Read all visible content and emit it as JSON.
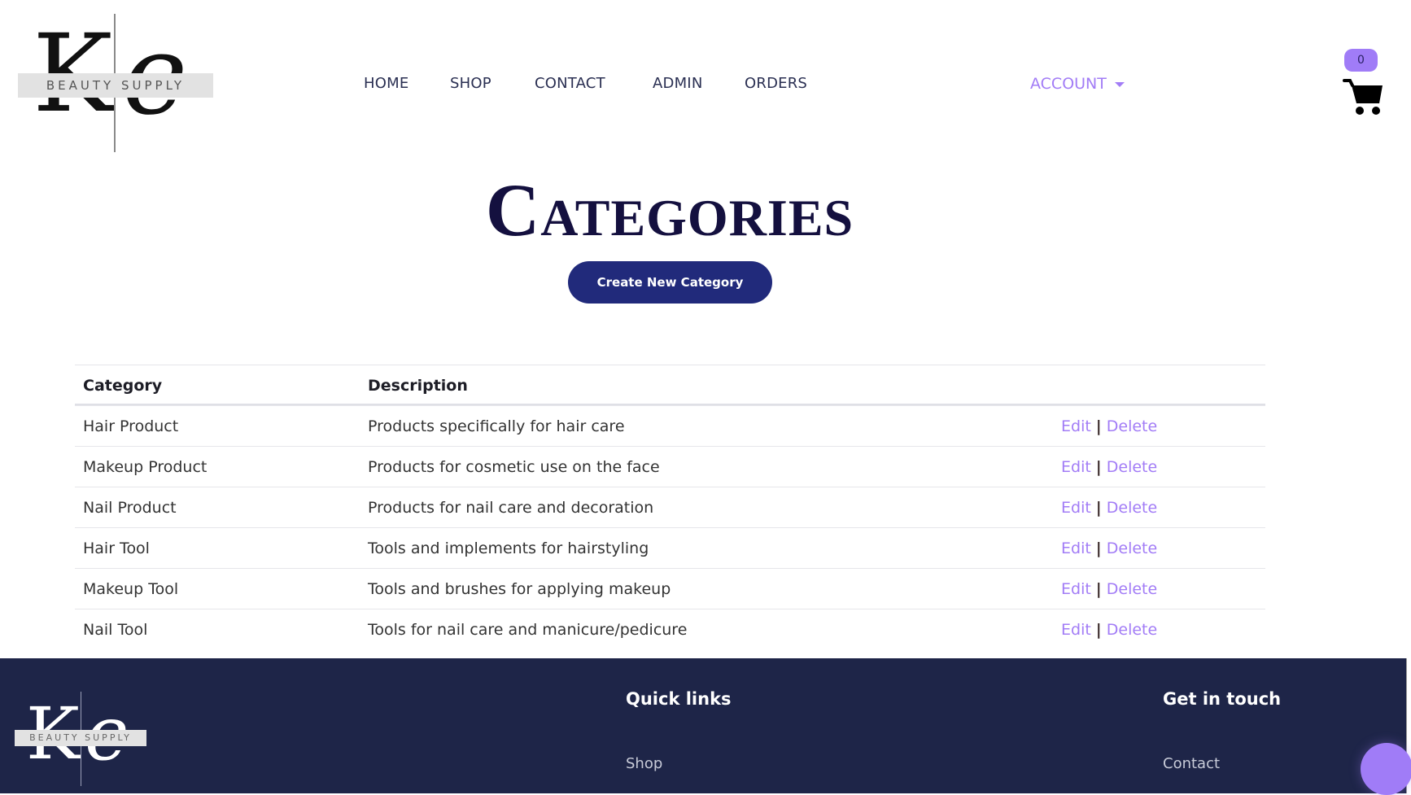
{
  "brand": {
    "logo_letters": [
      "K",
      "e"
    ],
    "logo_tagline": "BEAUTY SUPPLY"
  },
  "nav": {
    "items": [
      {
        "label": "HOME"
      },
      {
        "label": "SHOP"
      },
      {
        "label": "CONTACT"
      },
      {
        "label": "ADMIN"
      },
      {
        "label": "ORDERS"
      }
    ],
    "account_label": "ACCOUNT",
    "cart_count": "0"
  },
  "page": {
    "title": "Categories",
    "create_button": "Create New Category"
  },
  "table": {
    "headers": [
      "Category",
      "Description",
      ""
    ],
    "rows": [
      {
        "category": "Hair Product",
        "description": "Products specifically for hair care",
        "edit": "Edit",
        "delete": "Delete"
      },
      {
        "category": "Makeup Product",
        "description": "Products for cosmetic use on the face",
        "edit": "Edit",
        "delete": "Delete"
      },
      {
        "category": "Nail Product",
        "description": "Products for nail care and decoration",
        "edit": "Edit",
        "delete": "Delete"
      },
      {
        "category": "Hair Tool",
        "description": "Tools and implements for hairstyling",
        "edit": "Edit",
        "delete": "Delete"
      },
      {
        "category": "Makeup Tool",
        "description": "Tools and brushes for applying makeup",
        "edit": "Edit",
        "delete": "Delete"
      },
      {
        "category": "Nail Tool",
        "description": "Tools for nail care and manicure/pedicure",
        "edit": "Edit",
        "delete": "Delete"
      }
    ],
    "separator": "|"
  },
  "footer": {
    "quick_links_title": "Quick links",
    "quick_links": [
      "Shop"
    ],
    "get_in_touch_title": "Get in touch",
    "get_in_touch_links": [
      "Contact"
    ]
  },
  "colors": {
    "accent": "#a27cf6",
    "primary_button": "#212a7b",
    "title": "#14103f",
    "footer_bg": "#1e2548"
  }
}
